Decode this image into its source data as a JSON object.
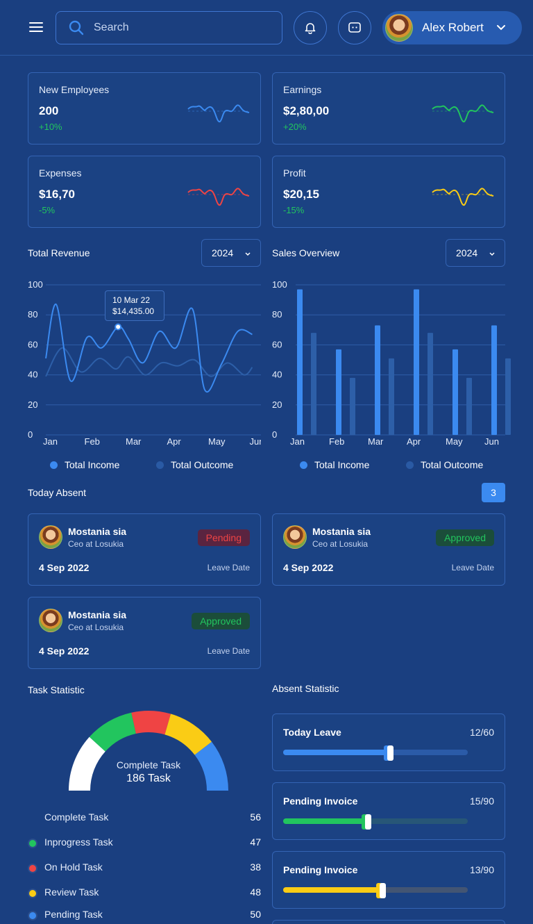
{
  "header": {
    "search_placeholder": "Search",
    "user_name": "Alex Robert"
  },
  "stats": [
    {
      "label": "New Employees",
      "value": "200",
      "change": "+10%",
      "color": "#3b8af0"
    },
    {
      "label": "Earnings",
      "value": "$2,80,00",
      "change": "+20%",
      "color": "#22c55e"
    },
    {
      "label": "Expenses",
      "value": "$16,70",
      "change": "-5%",
      "color": "#ef4444"
    },
    {
      "label": "Profit",
      "value": "$20,15",
      "change": "-15%",
      "color": "#facc15"
    }
  ],
  "revenue": {
    "title": "Total Revenue",
    "year": "2024",
    "tooltip_date": "10 Mar 22",
    "tooltip_value": "$14,435.00",
    "legend_income": "Total Income",
    "legend_outcome": "Total Outcome"
  },
  "sales": {
    "title": "Sales Overview",
    "year": "2024",
    "legend_income": "Total Income",
    "legend_outcome": "Total Outcome"
  },
  "chart_data": [
    {
      "type": "line",
      "title": "Total Revenue",
      "x": [
        "Jan",
        "Feb",
        "Mar",
        "Apr",
        "May",
        "Jun"
      ],
      "ylim": [
        0,
        100
      ],
      "yticks": [
        0,
        20,
        40,
        60,
        80,
        100
      ],
      "series": [
        {
          "name": "Total Income",
          "x": [
            0,
            0.25,
            0.6,
            1.0,
            1.35,
            1.75,
            2.0,
            2.35,
            2.75,
            3.15,
            3.55,
            3.85,
            4.25,
            4.65,
            5.0
          ],
          "y": [
            51,
            87,
            36,
            65,
            58,
            72,
            64,
            48,
            69,
            58,
            84,
            30,
            47,
            69,
            67
          ]
        },
        {
          "name": "Total Outcome",
          "x": [
            0,
            0.4,
            0.85,
            1.3,
            1.7,
            2.0,
            2.4,
            2.8,
            3.2,
            3.6,
            4.0,
            4.4,
            4.8,
            5.0
          ],
          "y": [
            39,
            58,
            42,
            51,
            44,
            52,
            40,
            48,
            46,
            50,
            39,
            48,
            40,
            45
          ]
        }
      ],
      "grid": true,
      "legend": "bottom"
    },
    {
      "type": "bar",
      "title": "Sales Overview",
      "categories": [
        "Jan",
        "Feb",
        "Mar",
        "Apr",
        "May",
        "Jun"
      ],
      "ylim": [
        0,
        100
      ],
      "yticks": [
        0,
        20,
        40,
        60,
        80,
        100
      ],
      "series": [
        {
          "name": "Total Income",
          "values": [
            97,
            57,
            73,
            97,
            57,
            73
          ]
        },
        {
          "name": "Total Outcome",
          "values": [
            68,
            38,
            51,
            68,
            38,
            51
          ]
        }
      ],
      "grid": true,
      "legend": "bottom"
    }
  ],
  "absent": {
    "title": "Today Absent",
    "count": "3",
    "items": [
      {
        "name": "Mostania sia",
        "role": "Ceo at Losukia",
        "status": "Pending",
        "date": "4 Sep 2022",
        "date_label": "Leave Date"
      },
      {
        "name": "Mostania sia",
        "role": "Ceo at Losukia",
        "status": "Approved",
        "date": "4 Sep 2022",
        "date_label": "Leave Date"
      },
      {
        "name": "Mostania sia",
        "role": "Ceo at Losukia",
        "status": "Approved",
        "date": "4 Sep 2022",
        "date_label": "Leave Date"
      }
    ]
  },
  "task": {
    "title": "Task Statistic",
    "center_label": "Complete Task",
    "center_value": "186 Task",
    "segments_colors": [
      "#ffffff",
      "#22c55e",
      "#ef4444",
      "#facc15",
      "#3b8af0"
    ],
    "rows": [
      {
        "label": "Complete Task",
        "value": "56",
        "color": "#ffffff"
      },
      {
        "label": "Inprogress Task",
        "value": "47",
        "color": "#22c55e"
      },
      {
        "label": "On Hold Task",
        "value": "38",
        "color": "#ef4444"
      },
      {
        "label": "Review Task",
        "value": "48",
        "color": "#facc15"
      },
      {
        "label": "Pending Task",
        "value": "50",
        "color": "#3b8af0"
      }
    ]
  },
  "absent_stat": {
    "title": "Absent Statistic",
    "items": [
      {
        "label": "Today Leave",
        "count": "12/60",
        "fraction": 0.57,
        "color": "#3b8af0",
        "track": "#2b5ba8"
      },
      {
        "label": "Pending Invoice",
        "count": "15/90",
        "fraction": 0.45,
        "color": "#22c55e",
        "track": "#275677"
      },
      {
        "label": "Pending Invoice",
        "count": "13/90",
        "fraction": 0.53,
        "color": "#facc15",
        "track": "#435573"
      }
    ]
  }
}
